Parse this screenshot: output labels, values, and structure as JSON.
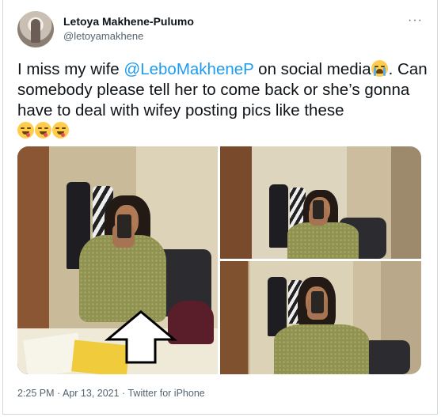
{
  "author": {
    "name": "Letoya Makhene-Pulumo",
    "handle": "@letoyamakhene"
  },
  "menu": {
    "more_label": "···"
  },
  "tweet": {
    "line1_pre": "I miss my wife ",
    "mention": "@LeboMakheneP",
    "line1_post": " on social media",
    "emoji_sob": "loudly-crying-face",
    "period": ".",
    "rest": " Can somebody please tell her to come back or she’s gonna have to deal with wifey posting pics like these",
    "emoji_yum": "face-savoring-food"
  },
  "media": {
    "photos": [
      "photo-1",
      "photo-2",
      "photo-3"
    ],
    "overlay": "up-arrow"
  },
  "meta": {
    "time": "2:25 PM",
    "sep1": " · ",
    "date": "Apr 13, 2021",
    "sep2": " · ",
    "source": "Twitter for iPhone"
  },
  "colors": {
    "link": "#1d9bf0",
    "secondary": "#536471",
    "text": "#0f1419"
  }
}
